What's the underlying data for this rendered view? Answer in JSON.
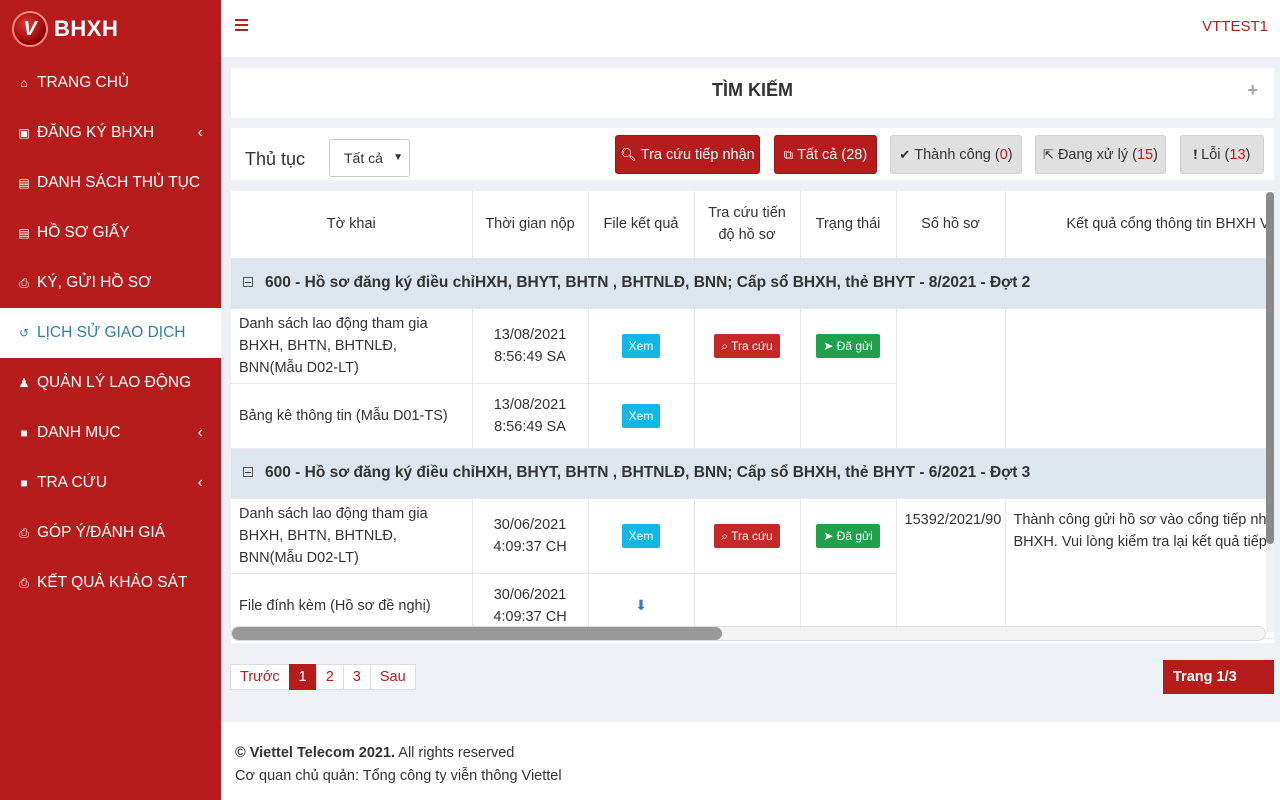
{
  "brand": {
    "logo_letter": "V",
    "name": "BHXH"
  },
  "sidebar": {
    "items": [
      {
        "label": "TRANG CHỦ",
        "icon": "home-icon",
        "glyph": "⌂",
        "chevron": false,
        "active": false
      },
      {
        "label": "ĐĂNG KÝ BHXH",
        "icon": "id-card-icon",
        "glyph": "▣",
        "chevron": true,
        "active": false
      },
      {
        "label": "DANH SÁCH THỦ TỤC",
        "icon": "document-icon",
        "glyph": "▤",
        "chevron": false,
        "active": false
      },
      {
        "label": "HỒ SƠ GIẤY",
        "icon": "document-icon",
        "glyph": "▤",
        "chevron": false,
        "active": false
      },
      {
        "label": "KÝ, GỬI HỒ SƠ",
        "icon": "print-icon",
        "glyph": "⎙",
        "chevron": false,
        "active": false
      },
      {
        "label": "LỊCH SỬ GIAO DỊCH",
        "icon": "history-icon",
        "glyph": "↺",
        "chevron": false,
        "active": true
      },
      {
        "label": "QUẢN LÝ LAO ĐỘNG",
        "icon": "users-icon",
        "glyph": "♟",
        "chevron": false,
        "active": false
      },
      {
        "label": "DANH MỤC",
        "icon": "box-icon",
        "glyph": "■",
        "chevron": true,
        "active": false
      },
      {
        "label": "TRA CỨU",
        "icon": "box-icon",
        "glyph": "■",
        "chevron": true,
        "active": false
      },
      {
        "label": "GÓP Ý/ĐÁNH GIÁ",
        "icon": "print-icon",
        "glyph": "⎙",
        "chevron": false,
        "active": false
      },
      {
        "label": "KẾT QUẢ KHẢO SÁT",
        "icon": "print-icon",
        "glyph": "⎙",
        "chevron": false,
        "active": false
      }
    ]
  },
  "topbar": {
    "user": "VTTEST1"
  },
  "search": {
    "title": "TÌM KIẾM",
    "expand": "+"
  },
  "filter": {
    "label": "Thủ tục",
    "select_value": "Tất cả",
    "buttons": {
      "lookup": "Tra cứu tiếp nhận",
      "all": "Tất cả",
      "all_count": "28",
      "success": "Thành công",
      "success_count": "0",
      "processing": "Đang xử lý",
      "processing_count": "15",
      "error": "Lỗi",
      "error_count": "13"
    }
  },
  "table": {
    "headers": {
      "form": "Tờ khai",
      "submitted": "Thời gian nộp",
      "result_file": "File kết quả",
      "track_line1": "Tra cứu tiến",
      "track_line2": "độ hồ sơ",
      "status": "Trạng thái",
      "record_no": "Số hồ sơ",
      "portal_result": "Kết quả cổng thông tin BHXH V"
    },
    "groups": [
      {
        "title": "600 - Hồ sơ đăng ký điều chỉHXH, BHYT, BHTN , BHTNLĐ, BNN; Cấp sổ BHXH, thẻ BHYT - 8/2021 - Đợt 2",
        "rows": [
          {
            "form": "Danh sách lao động tham gia BHXH, BHTN, BHTNLĐ, BNN(Mẫu D02-LT)",
            "date": "13/08/2021",
            "time": "8:56:49 SA",
            "view": "Xem",
            "track": "Tra cứu",
            "status": "Đã gửi"
          },
          {
            "form": "Bảng kê thông tin (Mẫu D01-TS)",
            "date": "13/08/2021",
            "time": "8:56:49 SA",
            "view": "Xem"
          }
        ],
        "record_no": "",
        "portal_result": ""
      },
      {
        "title": "600 - Hồ sơ đăng ký điều chỉHXH, BHYT, BHTN , BHTNLĐ, BNN; Cấp sổ BHXH, thẻ BHYT - 6/2021 - Đợt 3",
        "rows": [
          {
            "form": "Danh sách lao động tham gia BHXH, BHTN, BHTNLĐ, BNN(Mẫu D02-LT)",
            "date": "30/06/2021",
            "time": "4:09:37 CH",
            "view": "Xem",
            "track": "Tra cứu",
            "status": "Đã gửi"
          },
          {
            "form": "File đính kèm (Hồ sơ đề nghị)",
            "date": "30/06/2021",
            "time": "4:09:37 CH",
            "download": true
          }
        ],
        "record_no": "15392/2021/90",
        "portal_result": "Thành công gửi hồ sơ vào cổng tiếp nhận BHXH. Vui lòng kiểm tra lại kết quả tiếp n"
      }
    ]
  },
  "pagination": {
    "prev": "Trước",
    "pages": [
      "1",
      "2",
      "3"
    ],
    "active": "1",
    "next": "Sau",
    "info": "Trang 1/3"
  },
  "footer": {
    "copyright_bold": "© Viettel Telecom 2021.",
    "copyright_rest": " All rights reserved",
    "owner": "Cơ quan chủ quản: Tổng công ty viễn thông Viettel"
  },
  "colors": {
    "primary": "#b71c1c",
    "active_text": "#2f7fa6",
    "cyan": "#12b7e6",
    "green": "#20a04a",
    "group_bg": "#dde6ee"
  }
}
